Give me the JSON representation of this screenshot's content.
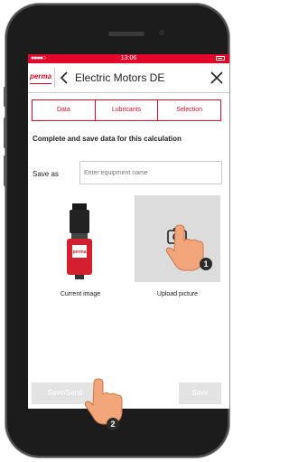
{
  "status_bar": {
    "carrier": "●●●●○",
    "time": "13:06"
  },
  "header": {
    "logo": "perma",
    "title": "Electric Motors DE",
    "back_icon": "chevron-left-icon",
    "close_icon": "close-icon"
  },
  "tabs": [
    {
      "label": "Data"
    },
    {
      "label": "Lubricants"
    },
    {
      "label": "Selection"
    }
  ],
  "main": {
    "heading": "Complete and save data for this calculation",
    "save_as_label": "Save as",
    "equipment_placeholder": "Enter equipment name",
    "product_label": "perma",
    "current_image_caption": "Current image",
    "upload_caption": "Upload picture"
  },
  "buttons": {
    "save_send": "Save/Send",
    "save": "Save"
  },
  "annotations": {
    "step1": "1",
    "step2": "2"
  },
  "colors": {
    "accent": "#e3072a",
    "disabled_button": "#e3e3e3",
    "upload_bg": "#dcdcdc"
  }
}
